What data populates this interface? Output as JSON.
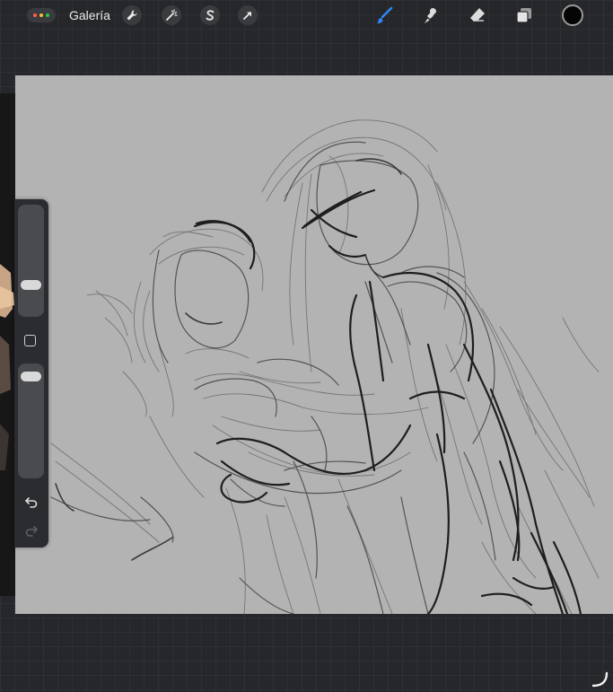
{
  "topbar": {
    "gallery_label": "Galería",
    "actions": [
      {
        "icon": "wrench-icon"
      },
      {
        "icon": "magic-wand-icon"
      },
      {
        "icon": "selection-icon"
      },
      {
        "icon": "transform-arrow-icon"
      }
    ],
    "tools": [
      {
        "icon": "brush-icon",
        "active": true
      },
      {
        "icon": "smudge-icon",
        "active": false
      },
      {
        "icon": "eraser-icon",
        "active": false
      },
      {
        "icon": "layers-icon",
        "active": false
      }
    ],
    "current_color": "#050505",
    "accent_color": "#2f86f5"
  },
  "sidebar": {
    "brush_size_level": 0.25,
    "opacity_level": 0.95,
    "modifier_icon": "square-modifier-icon",
    "undo_icon": "undo-icon",
    "redo_icon": "redo-icon"
  },
  "canvas": {
    "background": "#b3b3b3",
    "content": "pencil-sketch-two-figures"
  }
}
